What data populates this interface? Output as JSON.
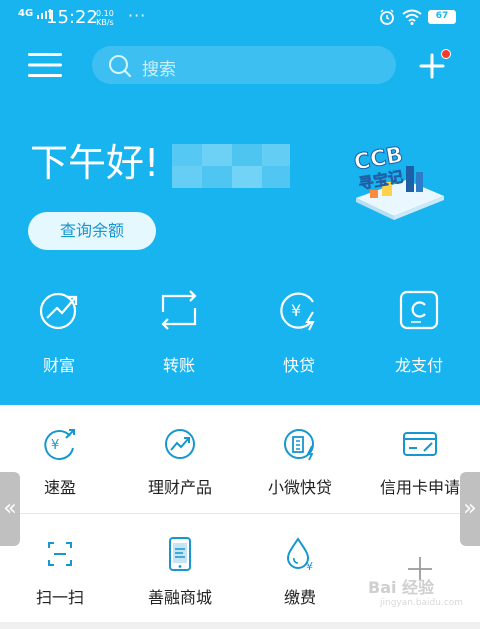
{
  "status_bar": {
    "network": "4G",
    "time": "15:22",
    "speed_value": "0.10",
    "speed_unit": "KB/s",
    "more_dots": "···",
    "battery": "67"
  },
  "header": {
    "search_placeholder": "搜索"
  },
  "hero": {
    "greeting": "下午好!",
    "balance_button": "查询余额",
    "logo_text": "CCB",
    "logo_subtext": "寻宝记"
  },
  "main_actions": [
    {
      "label": "财富",
      "icon": "wealth-icon"
    },
    {
      "label": "转账",
      "icon": "transfer-icon"
    },
    {
      "label": "快贷",
      "icon": "quick-loan-icon"
    },
    {
      "label": "龙支付",
      "icon": "dragon-pay-icon"
    }
  ],
  "grid": [
    {
      "label": "速盈",
      "icon": "quick-profit-icon"
    },
    {
      "label": "理财产品",
      "icon": "finance-product-icon"
    },
    {
      "label": "小微快贷",
      "icon": "micro-loan-icon"
    },
    {
      "label": "信用卡申请",
      "icon": "credit-card-icon"
    },
    {
      "label": "扫一扫",
      "icon": "scan-icon"
    },
    {
      "label": "善融商城",
      "icon": "mall-icon"
    },
    {
      "label": "缴费",
      "icon": "payment-icon"
    },
    {
      "label": "",
      "icon": "add-icon"
    }
  ],
  "nav": {
    "left_arrow": "«",
    "right_arrow": "»"
  },
  "watermark": {
    "brand": "Bai 经验",
    "url": "jingyan.baidu.com"
  },
  "colors": {
    "hero_bg": "#18b4ef",
    "accent": "#1697cf",
    "notification_dot": "#f23a2e"
  }
}
